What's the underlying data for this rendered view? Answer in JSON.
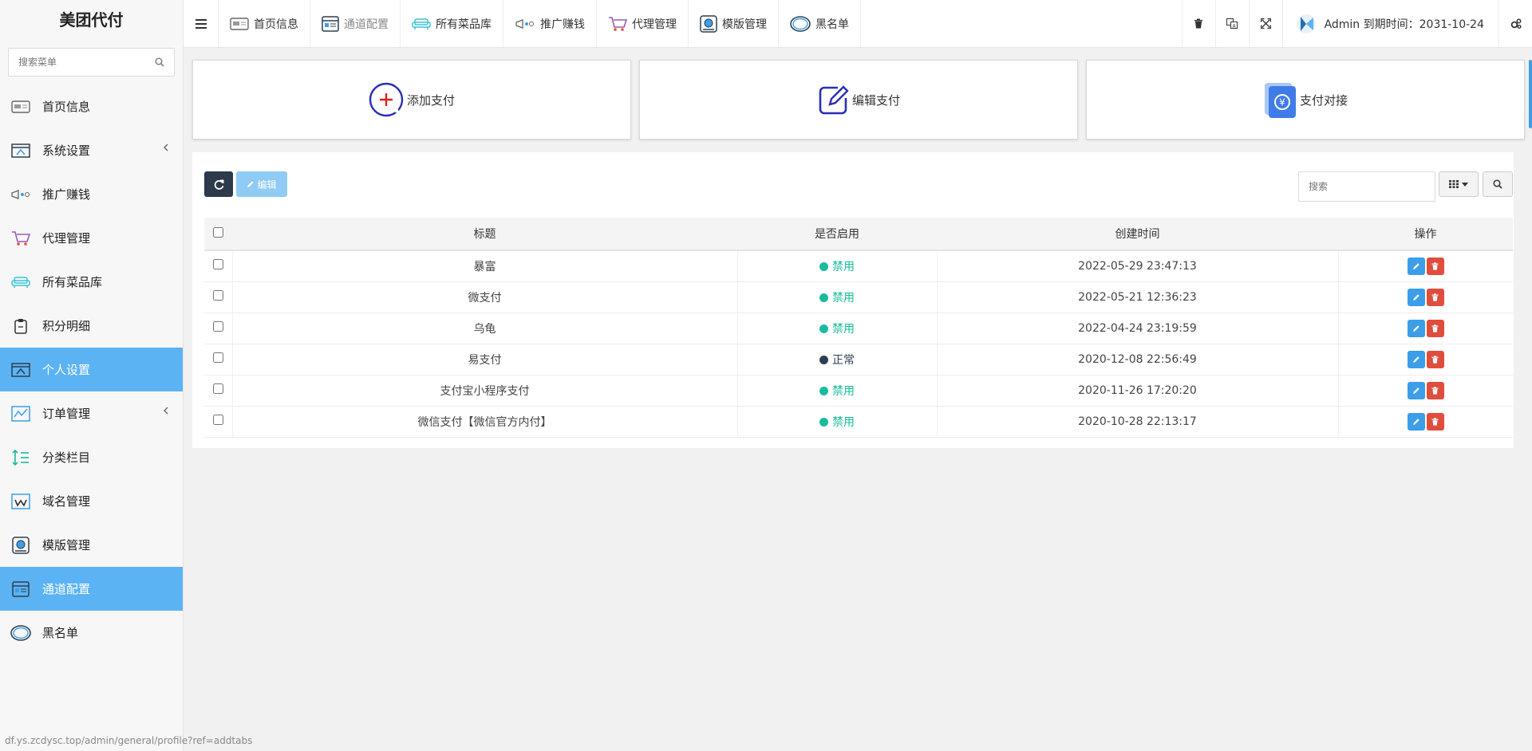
{
  "sidebar": {
    "logo": "美团代付",
    "search_placeholder": "搜索菜单",
    "items": [
      {
        "label": "首页信息",
        "icon": "home-card-icon",
        "active": false,
        "chevron": false
      },
      {
        "label": "系统设置",
        "icon": "settings-window-icon",
        "active": false,
        "chevron": true
      },
      {
        "label": "推广赚钱",
        "icon": "megaphone-icon",
        "active": false,
        "chevron": false
      },
      {
        "label": "代理管理",
        "icon": "cart-icon",
        "active": false,
        "chevron": false
      },
      {
        "label": "所有菜品库",
        "icon": "sofa-icon",
        "active": false,
        "chevron": false
      },
      {
        "label": "积分明细",
        "icon": "clipboard-icon",
        "active": false,
        "chevron": false
      },
      {
        "label": "个人设置",
        "icon": "profile-window-icon",
        "active": true,
        "chevron": false
      },
      {
        "label": "订单管理",
        "icon": "orders-icon",
        "active": false,
        "chevron": true
      },
      {
        "label": "分类栏目",
        "icon": "sort-icon",
        "active": false,
        "chevron": false
      },
      {
        "label": "域名管理",
        "icon": "domain-icon",
        "active": false,
        "chevron": false
      },
      {
        "label": "模版管理",
        "icon": "template-icon",
        "active": false,
        "chevron": false
      },
      {
        "label": "通道配置",
        "icon": "channel-icon",
        "active": true,
        "chevron": false
      },
      {
        "label": "黑名单",
        "icon": "ring-icon",
        "active": false,
        "chevron": false
      }
    ]
  },
  "topbar": {
    "tabs": [
      {
        "label": "首页信息",
        "icon": "home-card-icon",
        "active": false
      },
      {
        "label": "通道配置",
        "icon": "channel-icon",
        "active": true
      },
      {
        "label": "所有菜品库",
        "icon": "sofa-icon",
        "active": false
      },
      {
        "label": "推广赚钱",
        "icon": "megaphone-icon",
        "active": false
      },
      {
        "label": "代理管理",
        "icon": "cart-icon",
        "active": false
      },
      {
        "label": "模版管理",
        "icon": "template-icon",
        "active": false
      },
      {
        "label": "黑名单",
        "icon": "ring-icon",
        "active": false
      }
    ],
    "user_text": "Admin 到期时间：2031-10-24"
  },
  "cards": [
    {
      "label": "添加支付",
      "icon": "add-circle-icon"
    },
    {
      "label": "编辑支付",
      "icon": "edit-square-icon"
    },
    {
      "label": "支付对接",
      "icon": "yuan-book-icon"
    }
  ],
  "toolbar": {
    "edit_label": "编辑",
    "search_placeholder": "搜索"
  },
  "table": {
    "headers": [
      "标题",
      "是否启用",
      "创建时间",
      "操作"
    ],
    "rows": [
      {
        "title": "暴富",
        "status": "禁用",
        "status_color": "#18bc9c",
        "created": "2022-05-29 23:47:13"
      },
      {
        "title": "微支付",
        "status": "禁用",
        "status_color": "#18bc9c",
        "created": "2022-05-21 12:36:23"
      },
      {
        "title": "乌龟",
        "status": "禁用",
        "status_color": "#18bc9c",
        "created": "2022-04-24 23:19:59"
      },
      {
        "title": "易支付",
        "status": "正常",
        "status_color": "#2c3e50",
        "created": "2020-12-08 22:56:49"
      },
      {
        "title": "支付宝小程序支付",
        "status": "禁用",
        "status_color": "#18bc9c",
        "created": "2020-11-26 17:20:20"
      },
      {
        "title": "微信支付【微信官方内付】",
        "status": "禁用",
        "status_color": "#18bc9c",
        "created": "2020-10-28 22:13:17"
      }
    ]
  },
  "status_url": "df.ys.zcdysc.top/admin/general/profile?ref=addtabs",
  "colors": {
    "accent": "#5cb3f3",
    "dark_button": "#2c3a4c",
    "green": "#18bc9c",
    "danger": "#e04d3c"
  }
}
